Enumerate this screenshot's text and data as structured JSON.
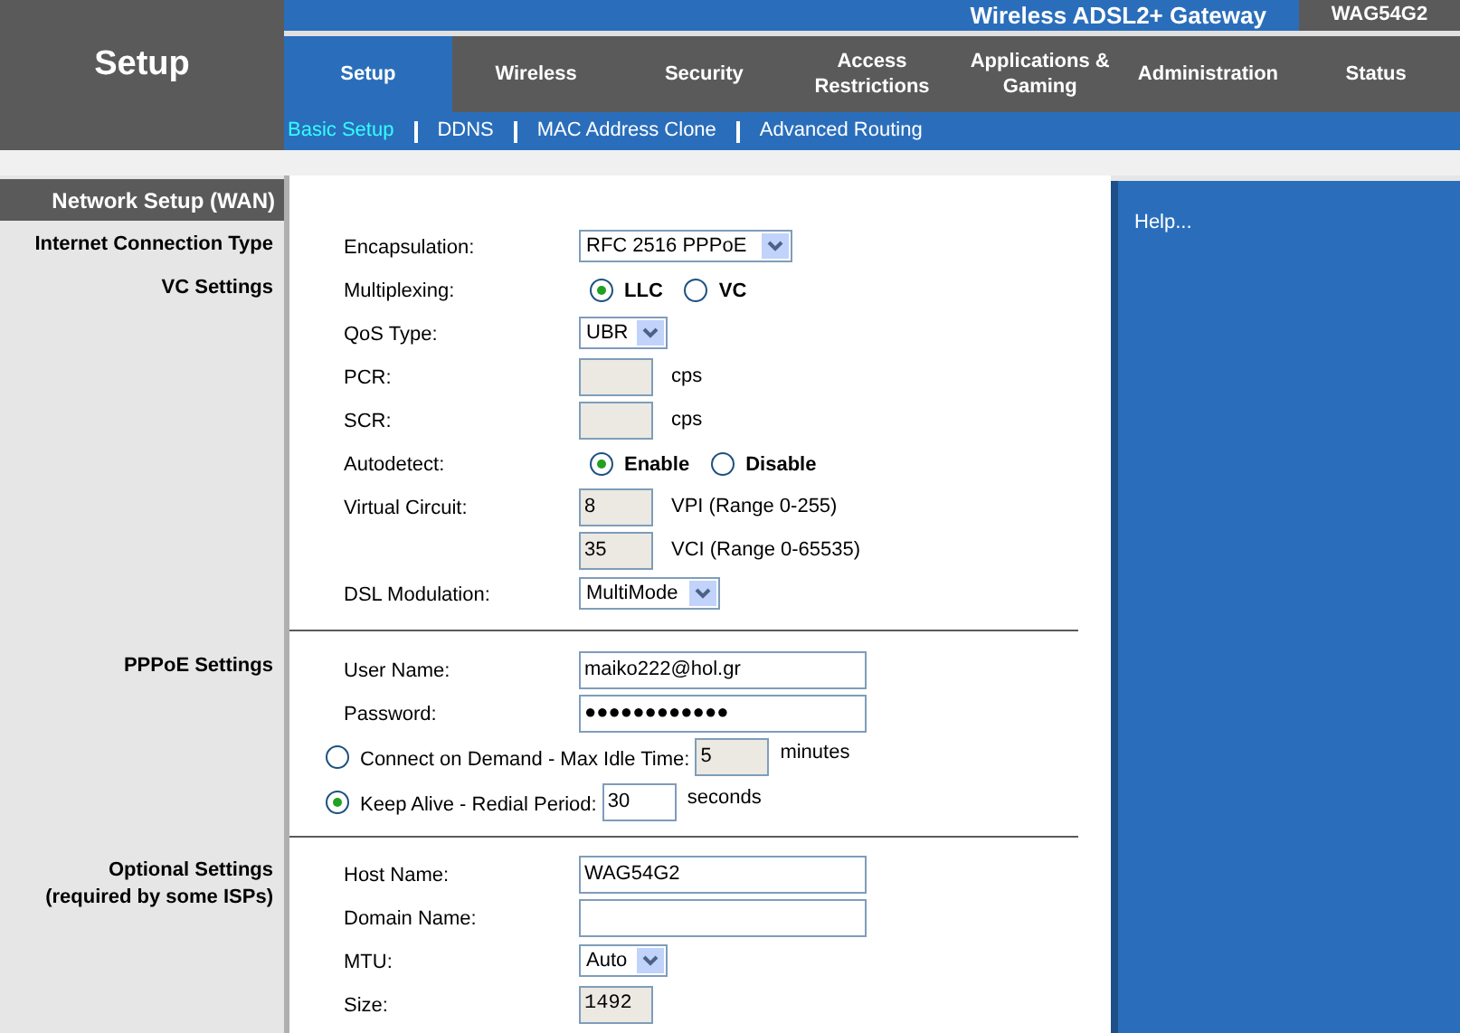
{
  "header": {
    "title": "Setup",
    "product": "Wireless ADSL2+ Gateway",
    "model": "WAG54G2"
  },
  "tabs": [
    {
      "label": "Setup",
      "selected": true
    },
    {
      "label": "Wireless",
      "selected": false
    },
    {
      "label": "Security",
      "selected": false
    },
    {
      "label": "Access Restrictions",
      "selected": false
    },
    {
      "label": "Applications & Gaming",
      "selected": false
    },
    {
      "label": "Administration",
      "selected": false
    },
    {
      "label": "Status",
      "selected": false
    }
  ],
  "subnav": [
    {
      "label": "Basic Setup",
      "selected": true
    },
    {
      "label": "DDNS",
      "selected": false
    },
    {
      "label": "MAC Address Clone",
      "selected": false
    },
    {
      "label": "Advanced Routing",
      "selected": false
    }
  ],
  "page_heading": "Network Setup (WAN)",
  "sections": [
    {
      "labels": [
        "Internet Connection Type",
        "VC Settings"
      ],
      "rows": [
        {
          "kind": "select",
          "label": "Encapsulation:",
          "value": "RFC 2516 PPPoE"
        },
        {
          "kind": "radios",
          "label": "Multiplexing:",
          "options": [
            {
              "label": "LLC",
              "selected": true
            },
            {
              "label": "VC",
              "selected": false
            }
          ]
        },
        {
          "kind": "select",
          "label": "QoS Type:",
          "value": "UBR"
        },
        {
          "kind": "short_field",
          "label": "PCR:",
          "unit": "cps",
          "disabled": true
        },
        {
          "kind": "short_field",
          "label": "SCR:",
          "unit": "cps",
          "disabled": true
        },
        {
          "kind": "radios",
          "label": "Autodetect:",
          "options": [
            {
              "label": "Enable",
              "selected": true
            },
            {
              "label": "Disable",
              "selected": false
            }
          ]
        },
        {
          "kind": "short_field",
          "label": "Virtual Circuit:",
          "value": "8",
          "unit": "VPI (Range 0-255)",
          "disabled": true
        },
        {
          "kind": "short_field",
          "value": "35",
          "unit": "VCI (Range 0-65535)",
          "disabled": true
        },
        {
          "kind": "select",
          "label": "DSL Modulation:",
          "value": "MultiMode"
        }
      ]
    },
    {
      "labels": [
        "PPPoE Settings"
      ],
      "rows": [
        {
          "kind": "wide_field",
          "label": "User Name:",
          "value": "maiko222@hol.gr"
        },
        {
          "kind": "wide_field",
          "label": "Password:",
          "value": "●●●●●●●●●●●●"
        },
        {
          "kind": "option",
          "label": "Connect on Demand - Max Idle Time:",
          "selected": false,
          "value": "5",
          "unit": "minutes",
          "disabled": true
        },
        {
          "kind": "option",
          "label": "Keep Alive - Redial Period:",
          "selected": true,
          "value": "30",
          "unit": "seconds",
          "disabled": false
        }
      ]
    },
    {
      "labels": [
        "Optional Settings\n(required by some ISPs)"
      ],
      "rows": [
        {
          "kind": "wide_field",
          "label": "Host Name:",
          "value": "WAG54G2"
        },
        {
          "kind": "wide_field",
          "label": "Domain Name:"
        },
        {
          "kind": "select",
          "label": "MTU:",
          "value": "Auto"
        },
        {
          "kind": "short_field",
          "label": "Size:",
          "value": "1492",
          "disabled": true
        }
      ]
    }
  ],
  "help": {
    "link": "Help..."
  }
}
